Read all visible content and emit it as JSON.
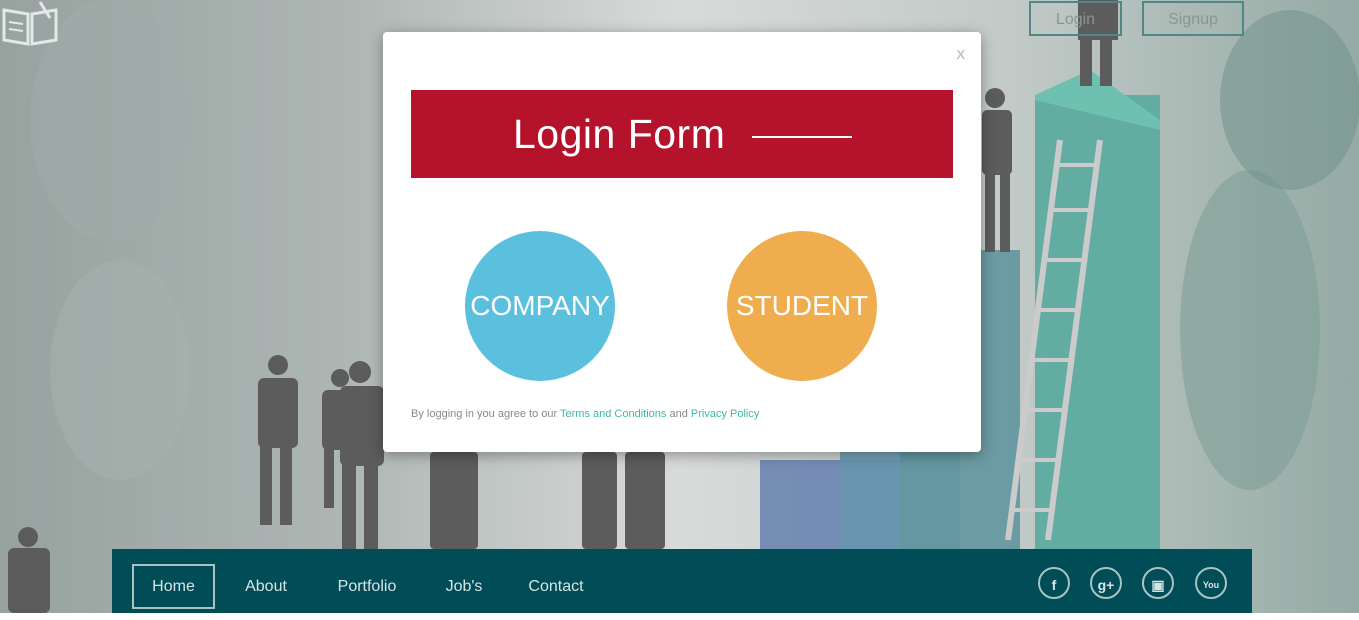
{
  "header": {
    "login_label": "Login",
    "signup_label": "Signup"
  },
  "modal": {
    "close_label": "x",
    "title": "Login Form",
    "options": {
      "company": "COMPANY",
      "student": "STUDENT"
    },
    "terms": {
      "prefix": "By logging in you agree to our",
      "terms_link": "Terms and Conditions",
      "joiner": "and",
      "privacy_link": "Privacy Policy"
    }
  },
  "nav": {
    "items": [
      {
        "label": "Home"
      },
      {
        "label": "About"
      },
      {
        "label": "Portfolio"
      },
      {
        "label": "Job's"
      },
      {
        "label": "Contact"
      }
    ],
    "social": {
      "facebook": "f",
      "google_plus": "g+",
      "instagram": "▣",
      "youtube": "You"
    }
  },
  "colors": {
    "banner": "#b5122b",
    "company": "#5bc0de",
    "student": "#f0ad4e",
    "navbar": "#004d57"
  },
  "icons": [
    "book-logo-icon",
    "close-icon",
    "facebook-icon",
    "google-plus-icon",
    "instagram-icon",
    "youtube-icon"
  ]
}
